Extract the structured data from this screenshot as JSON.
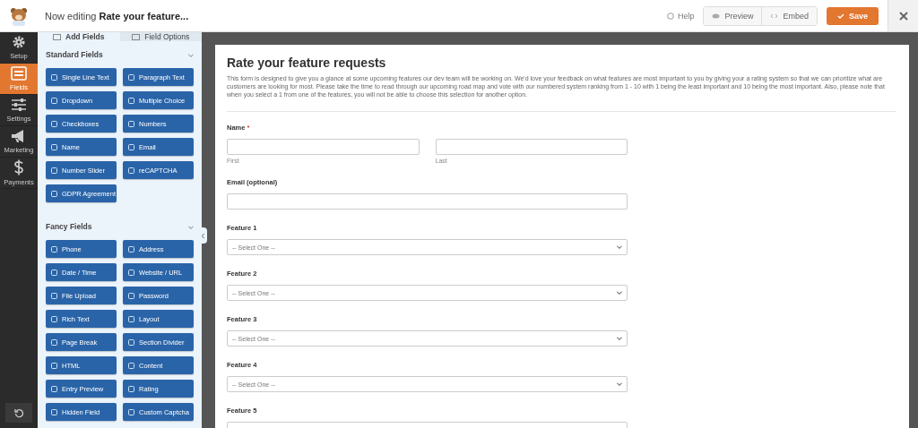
{
  "header": {
    "title": "Now editing **Rate your feature...**",
    "help": "Help",
    "preview": "Preview",
    "embed": "Embed",
    "save": "Save"
  },
  "nav": [
    {
      "label": "Setup",
      "selected": false
    },
    {
      "label": "Fields",
      "selected": true
    },
    {
      "label": "Settings",
      "selected": false
    },
    {
      "label": "Marketing",
      "selected": false
    },
    {
      "label": "Payments",
      "selected": false
    }
  ],
  "panel": {
    "tabs": [
      {
        "label": "Add Fields",
        "selected": true
      },
      {
        "label": "Field Options",
        "selected": false
      }
    ],
    "groups": [
      {
        "title": "Standard Fields",
        "expanded": true,
        "fields": [
          "Single Line Text",
          "Paragraph Text",
          "Dropdown",
          "Multiple Choice",
          "Checkboxes",
          "Numbers",
          "Name",
          "Email",
          "Number Slider",
          "reCAPTCHA",
          "GDPR Agreement"
        ]
      },
      {
        "title": "Fancy Fields",
        "expanded": true,
        "fields": [
          "Phone",
          "Address",
          "Date / Time",
          "Website / URL",
          "File Upload",
          "Password",
          "Rich Text",
          "Layout",
          "Page Break",
          "Section Divider",
          "HTML",
          "Content",
          "Entry Preview",
          "Rating",
          "Hidden Field",
          "Custom Captcha"
        ]
      }
    ]
  },
  "form": {
    "title": "Rate your feature requests",
    "description": "This form is designed to give you a glance at some upcoming features our dev team will be working on. We'd love your feedback on what features are most important to you by giving your a rating system so that we can prioritize what are customers are looking for most. Please take the time to read through our upcoming road map and vote with our numbered system ranking from 1 - 10 with 1 being the least important and 10 being the most important. Also, please note that when you select a 1 from one of the features, you will not be able to choose this selection for another option.",
    "fields": [
      {
        "kind": "name",
        "label": "Name",
        "required_mark": "*",
        "sublabels": [
          "First",
          "Last"
        ]
      },
      {
        "kind": "text",
        "label": "Email (optional)"
      },
      {
        "kind": "select",
        "label": "Feature 1",
        "placeholder": "-- Select One --"
      },
      {
        "kind": "select",
        "label": "Feature 2",
        "placeholder": "-- Select One --"
      },
      {
        "kind": "select",
        "label": "Feature 3",
        "placeholder": "-- Select One --"
      },
      {
        "kind": "select",
        "label": "Feature 4",
        "placeholder": "-- Select One --"
      },
      {
        "kind": "select",
        "label": "Feature 5"
      }
    ]
  }
}
